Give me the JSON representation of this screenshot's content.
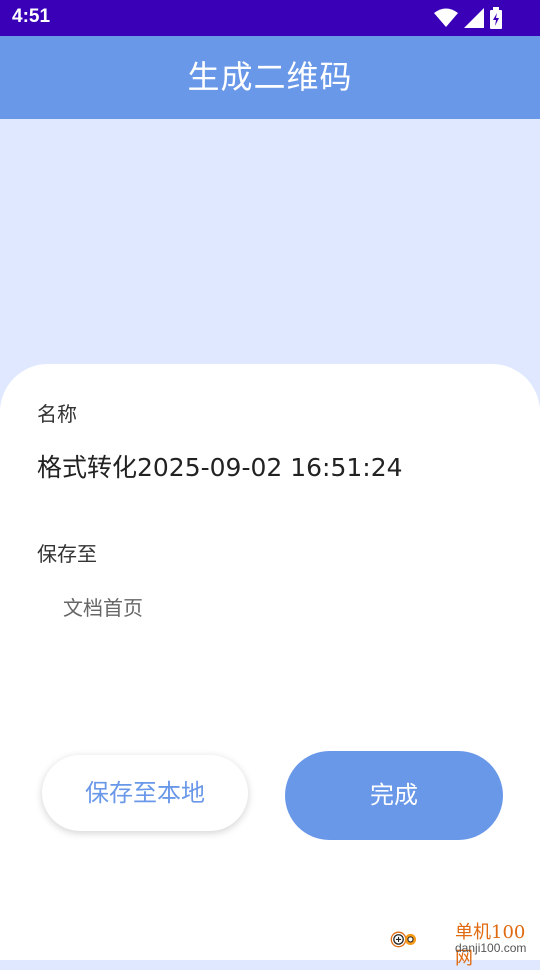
{
  "status_bar": {
    "time": "4:51"
  },
  "app_bar": {
    "title": "生成二维码"
  },
  "form": {
    "name_label": "名称",
    "name_value": "格式转化2025-09-02 16:51:24",
    "save_label": "保存至",
    "save_value": "文档首页"
  },
  "buttons": {
    "save_local": "保存至本地",
    "done": "完成"
  },
  "watermark": {
    "line1": "单机100网",
    "line2": "danji100.com"
  },
  "colors": {
    "status_bar": "#3a00b8",
    "app_bar": "#6a98e9",
    "background": "#dfe8ff",
    "accent": "#6a98e9"
  }
}
